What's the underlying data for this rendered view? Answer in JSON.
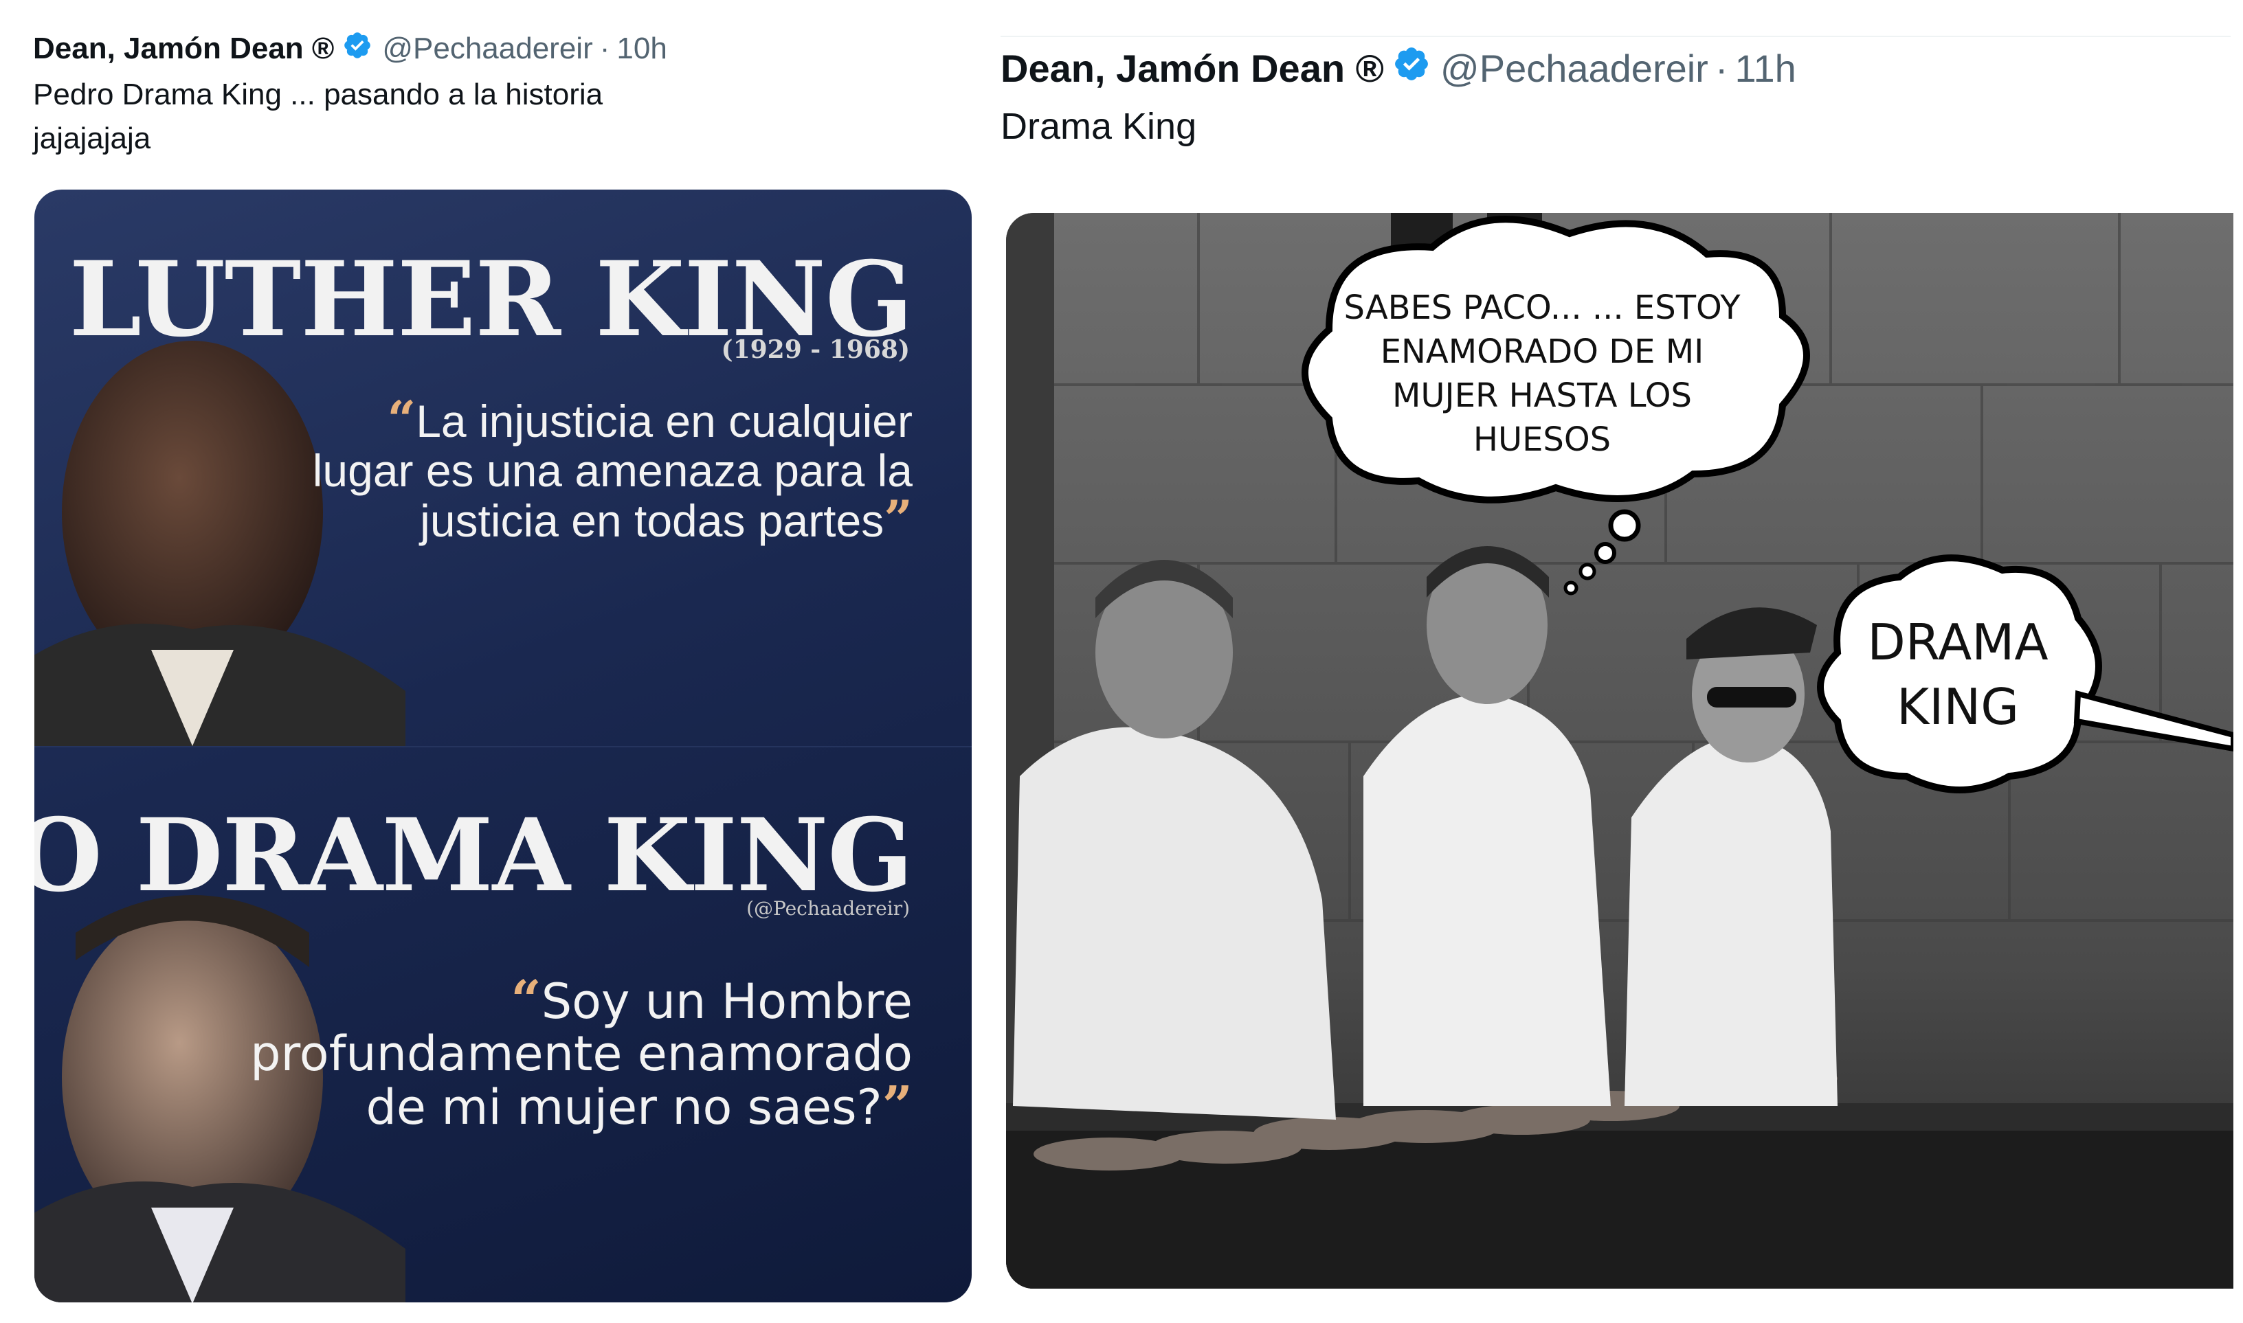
{
  "tweets": [
    {
      "name": "Dean, Jamón Dean ®",
      "handle": "@Pechaadereir",
      "time": "10h",
      "text": "Pedro Drama King ... pasando a la historia jajajajaja",
      "image": {
        "top_panel": {
          "title": "MARTIN LUTHER KING",
          "subtitle": "(1929 - 1968)",
          "quote": "La injusticia en cualquier lugar es una amenaza para la justicia en todas partes"
        },
        "bottom_panel": {
          "title": "PEDRO DRAMA KING",
          "subtitle": "(@Pechaadereir)",
          "quote": "Soy un Hombre profundamente enamorado de mi mujer no saes?"
        }
      }
    },
    {
      "name": "Dean, Jamón Dean ®",
      "handle": "@Pechaadereir",
      "time": "11h",
      "text": "Drama King",
      "image": {
        "thought_bubble": "SABES PACO... ... ESTOY ENAMORADO DE MI MUJER HASTA LOS HUESOS",
        "speech_bubble": "DRAMA KING"
      }
    }
  ],
  "colors": {
    "verified": "#1d9bf0",
    "secondary_text": "#536471",
    "primary_text": "#0f1419",
    "quote_marks": "#e8b07a"
  },
  "icons": {
    "verified": "verified-badge-icon"
  }
}
